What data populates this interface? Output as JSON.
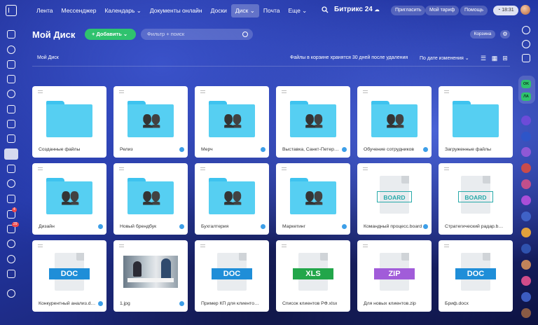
{
  "topbar": {
    "nav": [
      "Лента",
      "Мессенджер",
      "Календарь",
      "Документы онлайн",
      "Доски",
      "Диск",
      "Почта",
      "Еще"
    ],
    "active_index": 5,
    "portal_title": "Битрикс 24",
    "invite": "Пригласить",
    "plan": "Мой тариф",
    "help": "Помощь",
    "time": "18:31"
  },
  "header": {
    "title": "Мой Диск",
    "add_label": "Добавить",
    "filter_placeholder": "Фильтр + поиск",
    "trash_label": "Корзина"
  },
  "toolbar": {
    "breadcrumb": "Мой Диск",
    "trash_note": "Файлы в корзине хранятся 30 дней после удаления",
    "sort_label": "По дате изменения"
  },
  "left_sidebar": {
    "badges": [
      "4",
      "29"
    ]
  },
  "right_sidebar": {
    "tags": [
      "OK",
      "ЛА"
    ]
  },
  "files": [
    {
      "name": "Созданные файлы",
      "kind": "folder",
      "shared": false
    },
    {
      "name": "Релиз",
      "kind": "shared-folder",
      "shared": true
    },
    {
      "name": "Мерч",
      "kind": "shared-folder",
      "shared": true
    },
    {
      "name": "Выставка, Санкт-Петербург",
      "kind": "shared-folder",
      "shared": true
    },
    {
      "name": "Обучение сотрудников",
      "kind": "shared-folder",
      "shared": true
    },
    {
      "name": "Загруженные файлы",
      "kind": "folder",
      "shared": false
    },
    {
      "name": "Дизайн",
      "kind": "shared-folder",
      "shared": true
    },
    {
      "name": "Новый брендбук",
      "kind": "shared-folder",
      "shared": true
    },
    {
      "name": "Бухгалтерия",
      "kind": "shared-folder",
      "shared": true
    },
    {
      "name": "Маркетинг",
      "kind": "shared-folder",
      "shared": true
    },
    {
      "name": "Командный процесс.board",
      "kind": "board",
      "label": "BOARD",
      "shared": true
    },
    {
      "name": "Стратегический радар.board",
      "kind": "board",
      "label": "BOARD",
      "shared": false
    },
    {
      "name": "Конкурентный анализ.docx",
      "kind": "doc",
      "label": "DOC",
      "shared": true
    },
    {
      "name": "1.jpg",
      "kind": "image",
      "shared": true
    },
    {
      "name": "Пример КП для клиентов.docx",
      "kind": "doc",
      "label": "DOC",
      "shared": false
    },
    {
      "name": "Список клиентов РФ.xlsx",
      "kind": "xls",
      "label": "XLS",
      "shared": false
    },
    {
      "name": "Для новых клиентов.zip",
      "kind": "zip",
      "label": "ZIP",
      "shared": false
    },
    {
      "name": "Бриф.docx",
      "kind": "doc",
      "label": "DOC",
      "shared": false
    }
  ],
  "colors": {
    "accent_green": "#2fc26e",
    "folder_blue": "#56cff2",
    "doc_blue": "#1f8ed8",
    "xls_green": "#22a64a",
    "zip_purple": "#a15cd9",
    "board_teal": "#27a9a9"
  }
}
